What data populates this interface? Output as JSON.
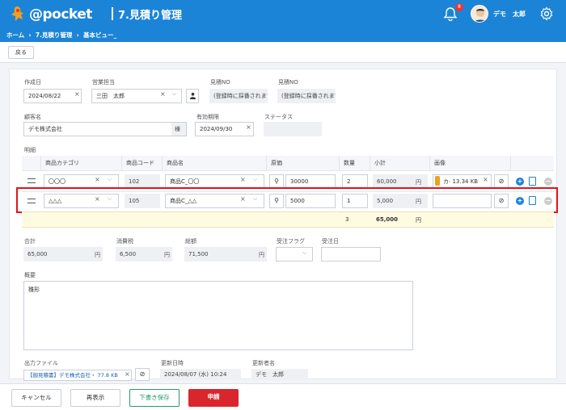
{
  "header": {
    "logo_text": "@pocket",
    "page_title": "7.見積り管理",
    "breadcrumb": [
      "ホーム",
      "7.見積り管理",
      "基本ビュー_"
    ],
    "notification_count": "8",
    "user_name": "デモ　太郎"
  },
  "toolbar": {
    "back_label": "戻る"
  },
  "form": {
    "created_date": {
      "label": "作成日",
      "value": "2024/08/22"
    },
    "sales_rep": {
      "label": "営業担当",
      "value": "三田　太郎"
    },
    "estimate_no_1": {
      "label": "見積NO",
      "value": "(登録時に採番されます)"
    },
    "estimate_no_2": {
      "label": "見積NO",
      "value": "(登録時に採番されます)"
    },
    "customer": {
      "label": "顧客名",
      "value": "デモ株式会社",
      "suffix": "様"
    },
    "valid_until": {
      "label": "有効期限",
      "value": "2024/09/30"
    },
    "status": {
      "label": "ステータス",
      "value": ""
    },
    "details_label": "明細"
  },
  "table": {
    "headers": [
      "商品カテゴリ",
      "商品コード",
      "商品名",
      "原価",
      "数量",
      "小計",
      "画像"
    ],
    "rows": [
      {
        "category": "〇〇〇",
        "code": "102",
        "name": "商品C_〇〇",
        "cost": "30000",
        "qty": "2",
        "subtotal": "60,000",
        "unit": "円",
        "image": "カ· 13.34 KB"
      },
      {
        "category": "△△△",
        "code": "105",
        "name": "商品C_△△",
        "cost": "5000",
        "qty": "1",
        "subtotal": "5,000",
        "unit": "円",
        "image": ""
      }
    ],
    "summary": {
      "qty": "3",
      "subtotal": "65,000",
      "unit": "円"
    }
  },
  "totals": {
    "total": {
      "label": "合計",
      "value": "65,000",
      "unit": "円"
    },
    "tax": {
      "label": "消費税",
      "value": "6,500",
      "unit": "円"
    },
    "grand": {
      "label": "総額",
      "value": "71,500",
      "unit": "円"
    },
    "order_flag": {
      "label": "受注フラグ",
      "value": ""
    },
    "order_date": {
      "label": "受注日",
      "value": ""
    }
  },
  "notes": {
    "label": "概要",
    "value": "雛形"
  },
  "output": {
    "file": {
      "label": "出力ファイル",
      "value": "【御見積書】デモ株式会社・ 77.8 KB"
    },
    "updated_at": {
      "label": "更新日時",
      "value": "2024/08/07 (水) 10:24"
    },
    "updated_by": {
      "label": "更新者名",
      "value": "デモ　太郎"
    }
  },
  "footer": {
    "cancel": "キャンセル",
    "redisplay": "再表示",
    "draft": "下書き保存",
    "apply": "申請"
  },
  "colors": {
    "header": "#1c84d6",
    "apply": "#d9262c",
    "highlight": "#e2141b",
    "draft_text": "#2a9a6a"
  }
}
